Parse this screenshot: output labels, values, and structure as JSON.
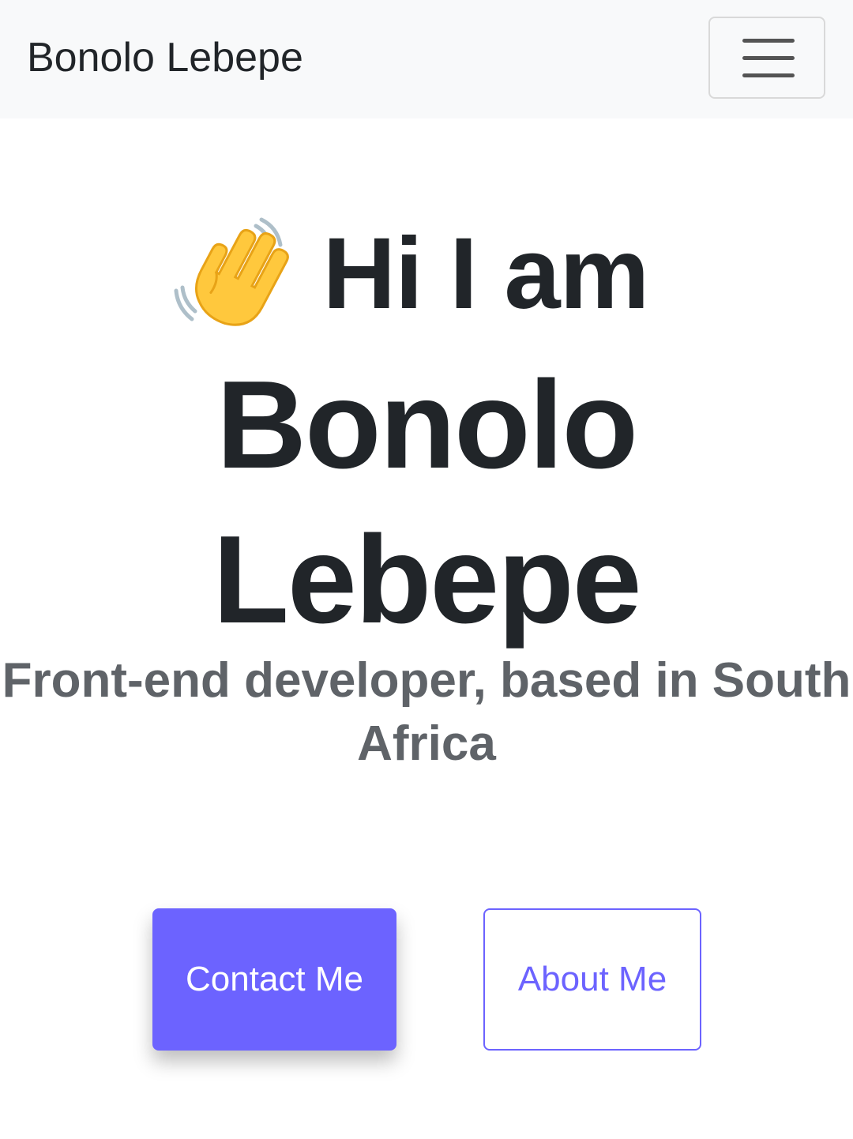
{
  "navbar": {
    "brand": "Bonolo Lebepe",
    "toggle_icon": "hamburger-menu-icon"
  },
  "hero": {
    "wave_icon": "waving-hand-icon",
    "greeting": "Hi I am",
    "name_line1": "Bonolo",
    "name_line2": "Lebepe",
    "subtitle_line1": "Front-end developer, based in South",
    "subtitle_line2": "Africa"
  },
  "buttons": {
    "contact_label": "Contact Me",
    "about_label": "About Me"
  },
  "colors": {
    "accent": "#6c63ff",
    "navbar_bg": "#f8f9fa",
    "text": "#212529",
    "muted_text": "#5f6368"
  }
}
